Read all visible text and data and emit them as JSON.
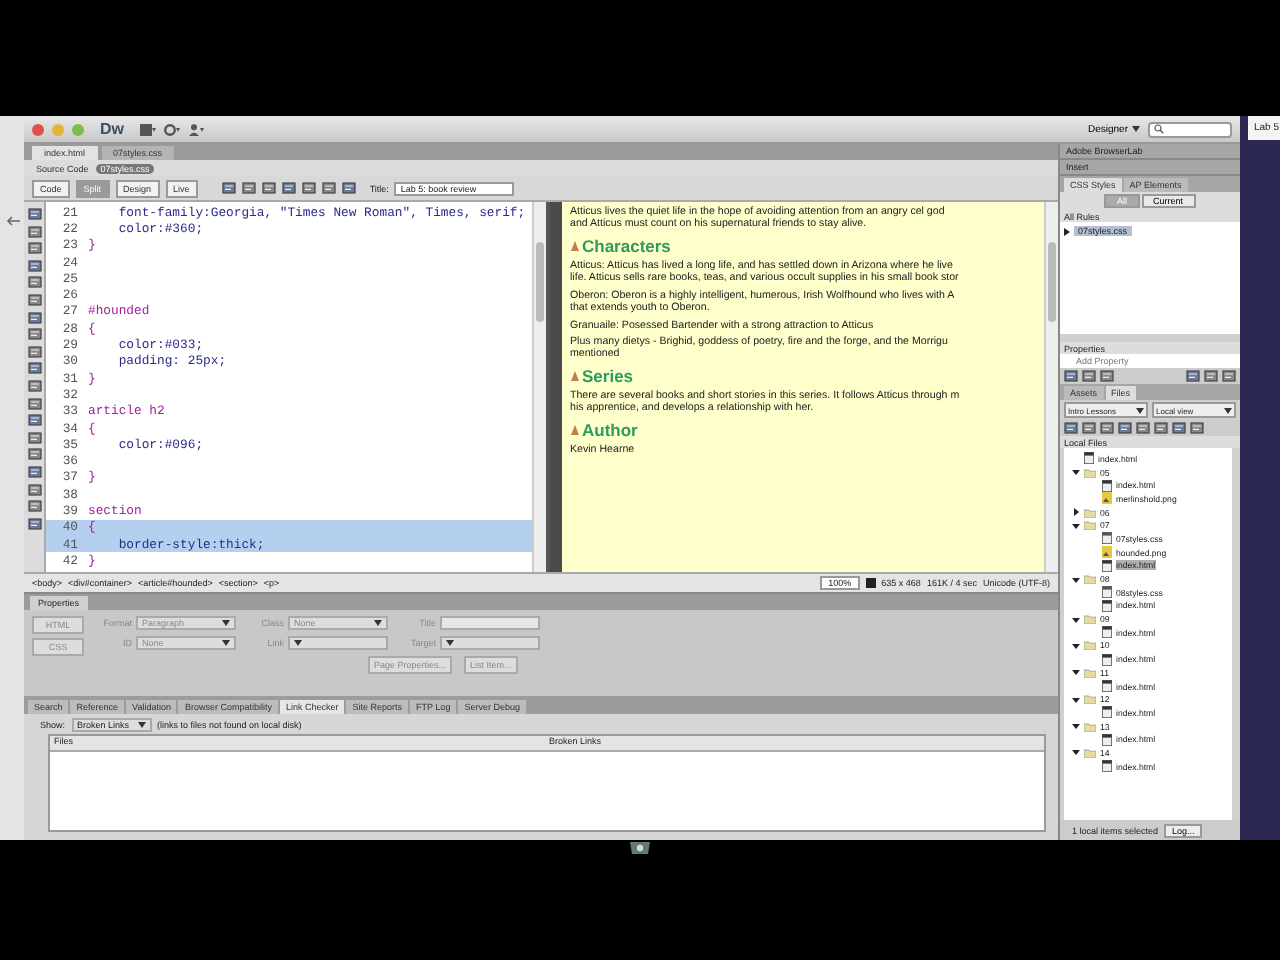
{
  "title_bar": {
    "logo": "Dw",
    "workspace": "Designer"
  },
  "desktop_tab": "Lab 5",
  "document": {
    "tabs": [
      {
        "label": "index.html",
        "selected": true
      },
      {
        "label": "07styles.css",
        "selected": false
      }
    ],
    "related_files": [
      {
        "label": "Source Code",
        "selected": false
      },
      {
        "label": "07styles.css",
        "selected": true
      }
    ],
    "view_buttons": [
      {
        "label": "Code",
        "selected": false
      },
      {
        "label": "Split",
        "selected": true
      },
      {
        "label": "Design",
        "selected": false
      },
      {
        "label": "Live",
        "selected": false
      }
    ],
    "title_label": "Title:",
    "title_value": "Lab 5: book review"
  },
  "code": {
    "lines": [
      {
        "num": "21",
        "text": "    font-family:Georgia, \"Times New Roman\", Times, serif;",
        "kind": "declaration",
        "selected": false
      },
      {
        "num": "22",
        "text": "    color:#360;",
        "kind": "declaration",
        "selected": false
      },
      {
        "num": "23",
        "text": "}",
        "kind": "brace",
        "selected": false
      },
      {
        "num": "24",
        "selected": false
      },
      {
        "num": "25",
        "selected": false
      },
      {
        "num": "26",
        "selected": false
      },
      {
        "num": "27",
        "text": "#hounded",
        "kind": "selector",
        "selected": false
      },
      {
        "num": "28",
        "text": "{",
        "kind": "brace",
        "selected": false
      },
      {
        "num": "29",
        "text": "    color:#033;",
        "kind": "declaration",
        "selected": false
      },
      {
        "num": "30",
        "text": "    padding: 25px;",
        "kind": "declaration",
        "selected": false
      },
      {
        "num": "31",
        "text": "}",
        "kind": "brace",
        "selected": false
      },
      {
        "num": "32",
        "selected": false
      },
      {
        "num": "33",
        "text": "article h2",
        "kind": "selector",
        "selected": false
      },
      {
        "num": "34",
        "text": "{",
        "kind": "brace",
        "selected": false
      },
      {
        "num": "35",
        "text": "    color:#096;",
        "kind": "declaration",
        "selected": false
      },
      {
        "num": "36",
        "selected": false
      },
      {
        "num": "37",
        "text": "}",
        "kind": "brace",
        "selected": false
      },
      {
        "num": "38",
        "selected": false
      },
      {
        "num": "39",
        "text": "section",
        "kind": "selector",
        "selected": false
      },
      {
        "num": "40",
        "text": "{",
        "kind": "brace",
        "selected": true
      },
      {
        "num": "41",
        "text": "    border-style:thick;",
        "kind": "declaration",
        "selected": true
      },
      {
        "num": "42",
        "text": "}",
        "kind": "brace",
        "selected": false
      }
    ]
  },
  "design": {
    "blocks": [
      {
        "kind": "p",
        "lines": [
          "Atticus lives the quiet life in the hope of avoiding attention from an angry cel god",
          "and Atticus must count on his supernatural friends to stay alive."
        ]
      },
      {
        "kind": "h2",
        "lines": [
          "Characters"
        ]
      },
      {
        "kind": "p",
        "lines": [
          "Atticus: Atticus has lived a long life, and has settled down in Arizona where he live",
          "life. Atticus sells rare books, teas, and various occult supplies in his small book stor"
        ]
      },
      {
        "kind": "p",
        "lines": [
          "Oberon: Oberon is a highly intelligent, humerous, Irish Wolfhound who lives with A",
          "that extends youth to Oberon."
        ]
      },
      {
        "kind": "p",
        "lines": [
          "Granuaile: Posessed Bartender with a strong attraction to Atticus"
        ]
      },
      {
        "kind": "p",
        "lines": [
          "Plus many dietys - Brighid, goddess of poetry, fire and the forge, and the Morrigu",
          "mentioned"
        ]
      },
      {
        "kind": "h2",
        "lines": [
          "Series"
        ]
      },
      {
        "kind": "p",
        "lines": [
          "There are several books and short stories in this series.  It follows Atticus through m",
          "his apprentice, and develops a relationship with her."
        ]
      },
      {
        "kind": "h2",
        "lines": [
          "Author"
        ]
      },
      {
        "kind": "p",
        "lines": [
          "Kevin Hearne"
        ]
      }
    ]
  },
  "tag_selector": [
    "<body>",
    "<div#container>",
    "<article#hounded>",
    "<section>",
    "<p>"
  ],
  "status": {
    "zoom": "100%",
    "size": "635 x 468",
    "download": "161K / 4 sec",
    "encoding": "Unicode (UTF-8)"
  },
  "properties": {
    "title": "Properties",
    "disabled": true,
    "modes": [
      "HTML",
      "CSS"
    ],
    "row1": [
      {
        "label": "Format",
        "value": "Paragraph"
      },
      {
        "label": "Class",
        "value": "None"
      }
    ],
    "row2": [
      {
        "label": "ID",
        "value": "None"
      },
      {
        "label": "Link"
      }
    ],
    "title_label": "Title",
    "target_label": "Target",
    "buttons": [
      "Page Properties...",
      "List Item..."
    ]
  },
  "results": {
    "tabs": [
      {
        "label": "Search",
        "selected": false
      },
      {
        "label": "Reference",
        "selected": false
      },
      {
        "label": "Validation",
        "selected": false
      },
      {
        "label": "Browser Compatibility",
        "selected": false
      },
      {
        "label": "Link Checker",
        "selected": true
      },
      {
        "label": "Site Reports",
        "selected": false
      },
      {
        "label": "FTP Log",
        "selected": false
      },
      {
        "label": "Server Debug",
        "selected": false
      }
    ],
    "show_label": "Show:",
    "show_value": "Broken Links",
    "hint": "(links to files not found on local disk)",
    "columns": [
      "Files",
      "Broken Links"
    ]
  },
  "panels": {
    "groups": [
      "Adobe BrowserLab",
      "Insert"
    ],
    "css_tabs": [
      {
        "label": "CSS Styles",
        "selected": true
      },
      {
        "label": "AP Elements",
        "selected": false
      }
    ],
    "mode_buttons": [
      {
        "label": "All",
        "selected": true
      },
      {
        "label": "Current",
        "selected": false
      }
    ],
    "rules_heading": "All Rules",
    "rules": [
      {
        "label": "07styles.css",
        "selected": true
      }
    ],
    "properties_heading": "Properties",
    "add_property": "Add Property",
    "files_tabs": [
      {
        "label": "Assets",
        "selected": false
      },
      {
        "label": "Files",
        "selected": true
      }
    ],
    "site": "Intro Lessons",
    "view": "Local view",
    "local_files": "Local Files",
    "tree": [
      {
        "name": "index.html",
        "kind": "html",
        "selected": false
      },
      {
        "name": "05",
        "kind": "folder",
        "expanded": true,
        "selected": false,
        "children": [
          {
            "name": "index.html",
            "kind": "html",
            "selected": false
          },
          {
            "name": "merlinshold.png",
            "kind": "image",
            "selected": false
          }
        ]
      },
      {
        "name": "06",
        "kind": "folder",
        "expanded": false,
        "selected": false
      },
      {
        "name": "07",
        "kind": "folder",
        "expanded": true,
        "selected": false,
        "children": [
          {
            "name": "07styles.css",
            "kind": "css",
            "selected": false
          },
          {
            "name": "hounded.png",
            "kind": "image",
            "selected": false
          },
          {
            "name": "index.html",
            "kind": "html",
            "selected": true
          }
        ]
      },
      {
        "name": "08",
        "kind": "folder",
        "expanded": true,
        "selected": false,
        "children": [
          {
            "name": "08styles.css",
            "kind": "css",
            "selected": false
          },
          {
            "name": "index.html",
            "kind": "html",
            "selected": false
          }
        ]
      },
      {
        "name": "09",
        "kind": "folder",
        "expanded": true,
        "selected": false,
        "children": [
          {
            "name": "index.html",
            "kind": "html",
            "selected": false
          }
        ]
      },
      {
        "name": "10",
        "kind": "folder",
        "expanded": true,
        "selected": false,
        "children": [
          {
            "name": "index.html",
            "kind": "html",
            "selected": false
          }
        ]
      },
      {
        "name": "11",
        "kind": "folder",
        "expanded": true,
        "selected": false,
        "children": [
          {
            "name": "index.html",
            "kind": "html",
            "selected": false
          }
        ]
      },
      {
        "name": "12",
        "kind": "folder",
        "expanded": true,
        "selected": false,
        "children": [
          {
            "name": "index.html",
            "kind": "html",
            "selected": false
          }
        ]
      },
      {
        "name": "13",
        "kind": "folder",
        "expanded": true,
        "selected": false,
        "children": [
          {
            "name": "index.html",
            "kind": "html",
            "selected": false
          }
        ]
      },
      {
        "name": "14",
        "kind": "folder",
        "expanded": true,
        "selected": false,
        "children": [
          {
            "name": "index.html",
            "kind": "html",
            "selected": false
          }
        ]
      }
    ],
    "status": "1 local items selected",
    "log_button": "Log..."
  }
}
